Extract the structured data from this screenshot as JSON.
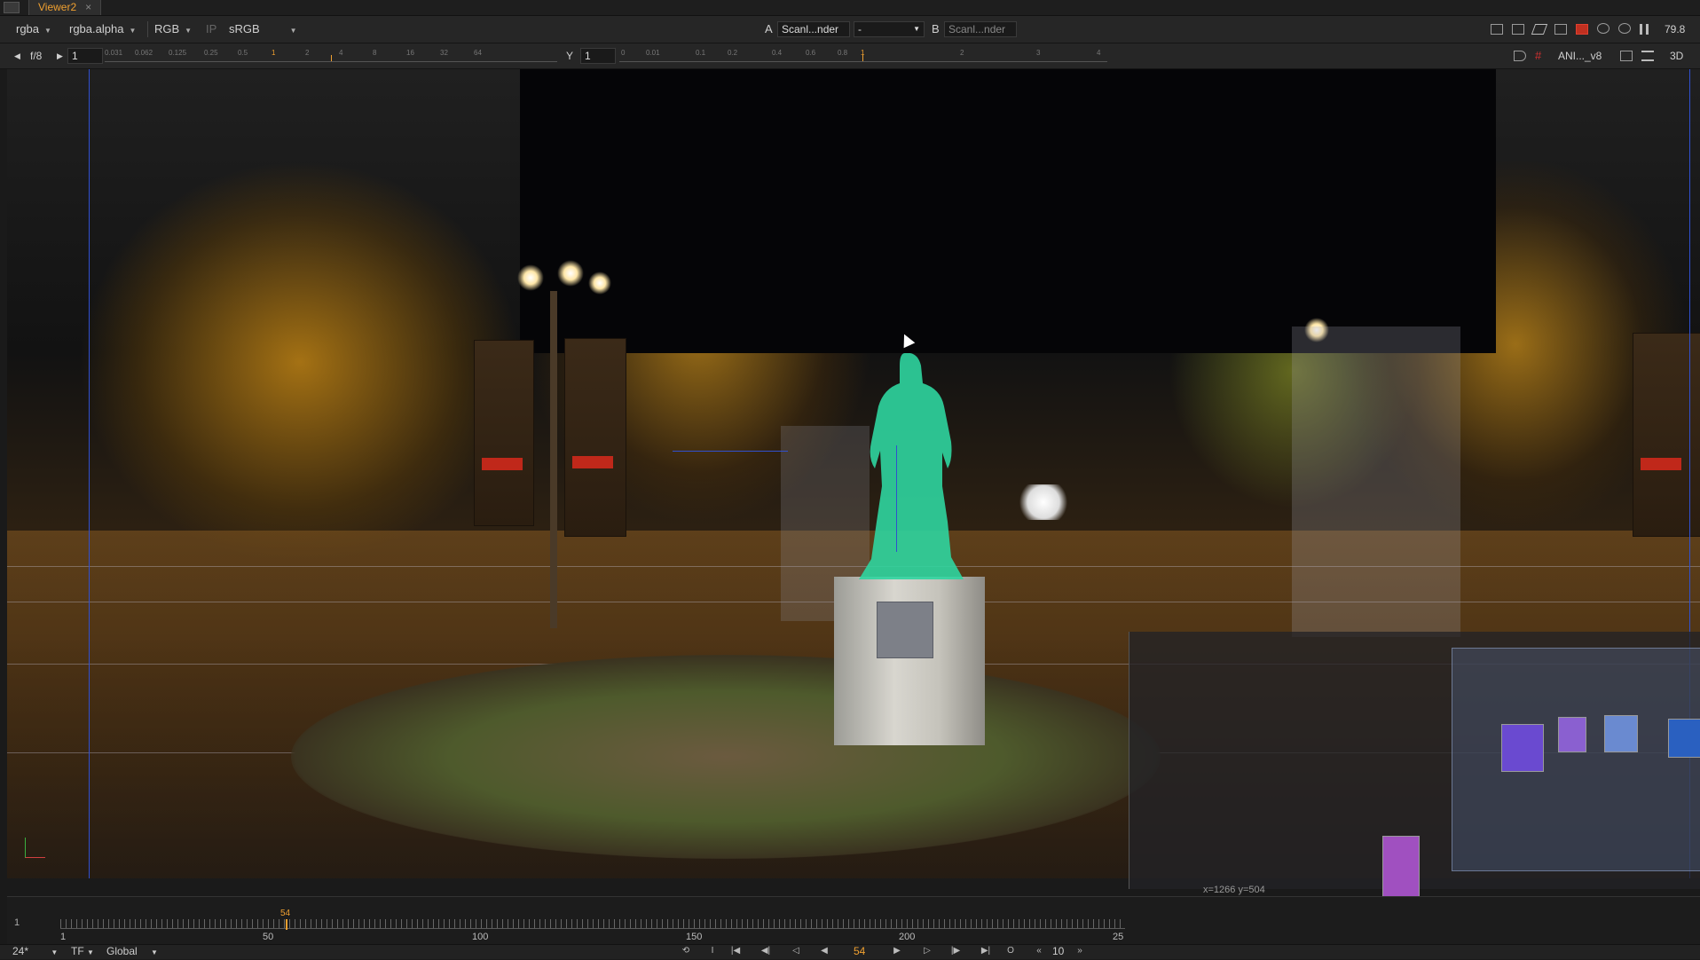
{
  "tab": {
    "title": "Viewer2",
    "close_glyph": "×"
  },
  "toolbar1": {
    "channels": "rgba",
    "alpha_channel": "rgba.alpha",
    "display_channels": "RGB",
    "ip_label": "IP",
    "lut": "sRGB",
    "input_a_label": "A",
    "input_a_value": "Scanl...nder",
    "wipe_mode": "-",
    "input_b_label": "B",
    "input_b_value": "Scanl...nder",
    "zoom": "79.8"
  },
  "toolbar2": {
    "fstop": "f/8",
    "gain": "1",
    "gain_ticks": [
      "0.031",
      "0.062",
      "0.125",
      "0.25",
      "0.5",
      "1",
      "2",
      "4",
      "8",
      "16",
      "32",
      "64"
    ],
    "gamma_label": "Y",
    "gamma": "1",
    "gamma_ticks": [
      "0",
      "0.01",
      "0.1",
      "0.2",
      "0.4",
      "0.6",
      "0.8",
      "1",
      "2",
      "3",
      "4"
    ],
    "view_select": "ANI..._v8",
    "mode_3d": "3D"
  },
  "viewer": {
    "coords_readout": "x=1266 y=504"
  },
  "timeline": {
    "current_frame": "54",
    "start_frame": "1",
    "tick_labels": [
      "1",
      "50",
      "100",
      "150",
      "200",
      "25"
    ]
  },
  "bottom_bar": {
    "fps": "24*",
    "tf": "TF",
    "scope": "Global",
    "in_point": "I",
    "out_point": "O",
    "frame_display": "54",
    "increment": "10"
  },
  "colors": {
    "accent_orange": "#f0a030",
    "guide_blue": "#3050d0",
    "statue_green": "#2fd5a0"
  },
  "icons": [
    "close-icon",
    "chevron-down-icon",
    "play-icon",
    "step-icon",
    "gear-icon",
    "pause-icon",
    "refresh-icon"
  ]
}
